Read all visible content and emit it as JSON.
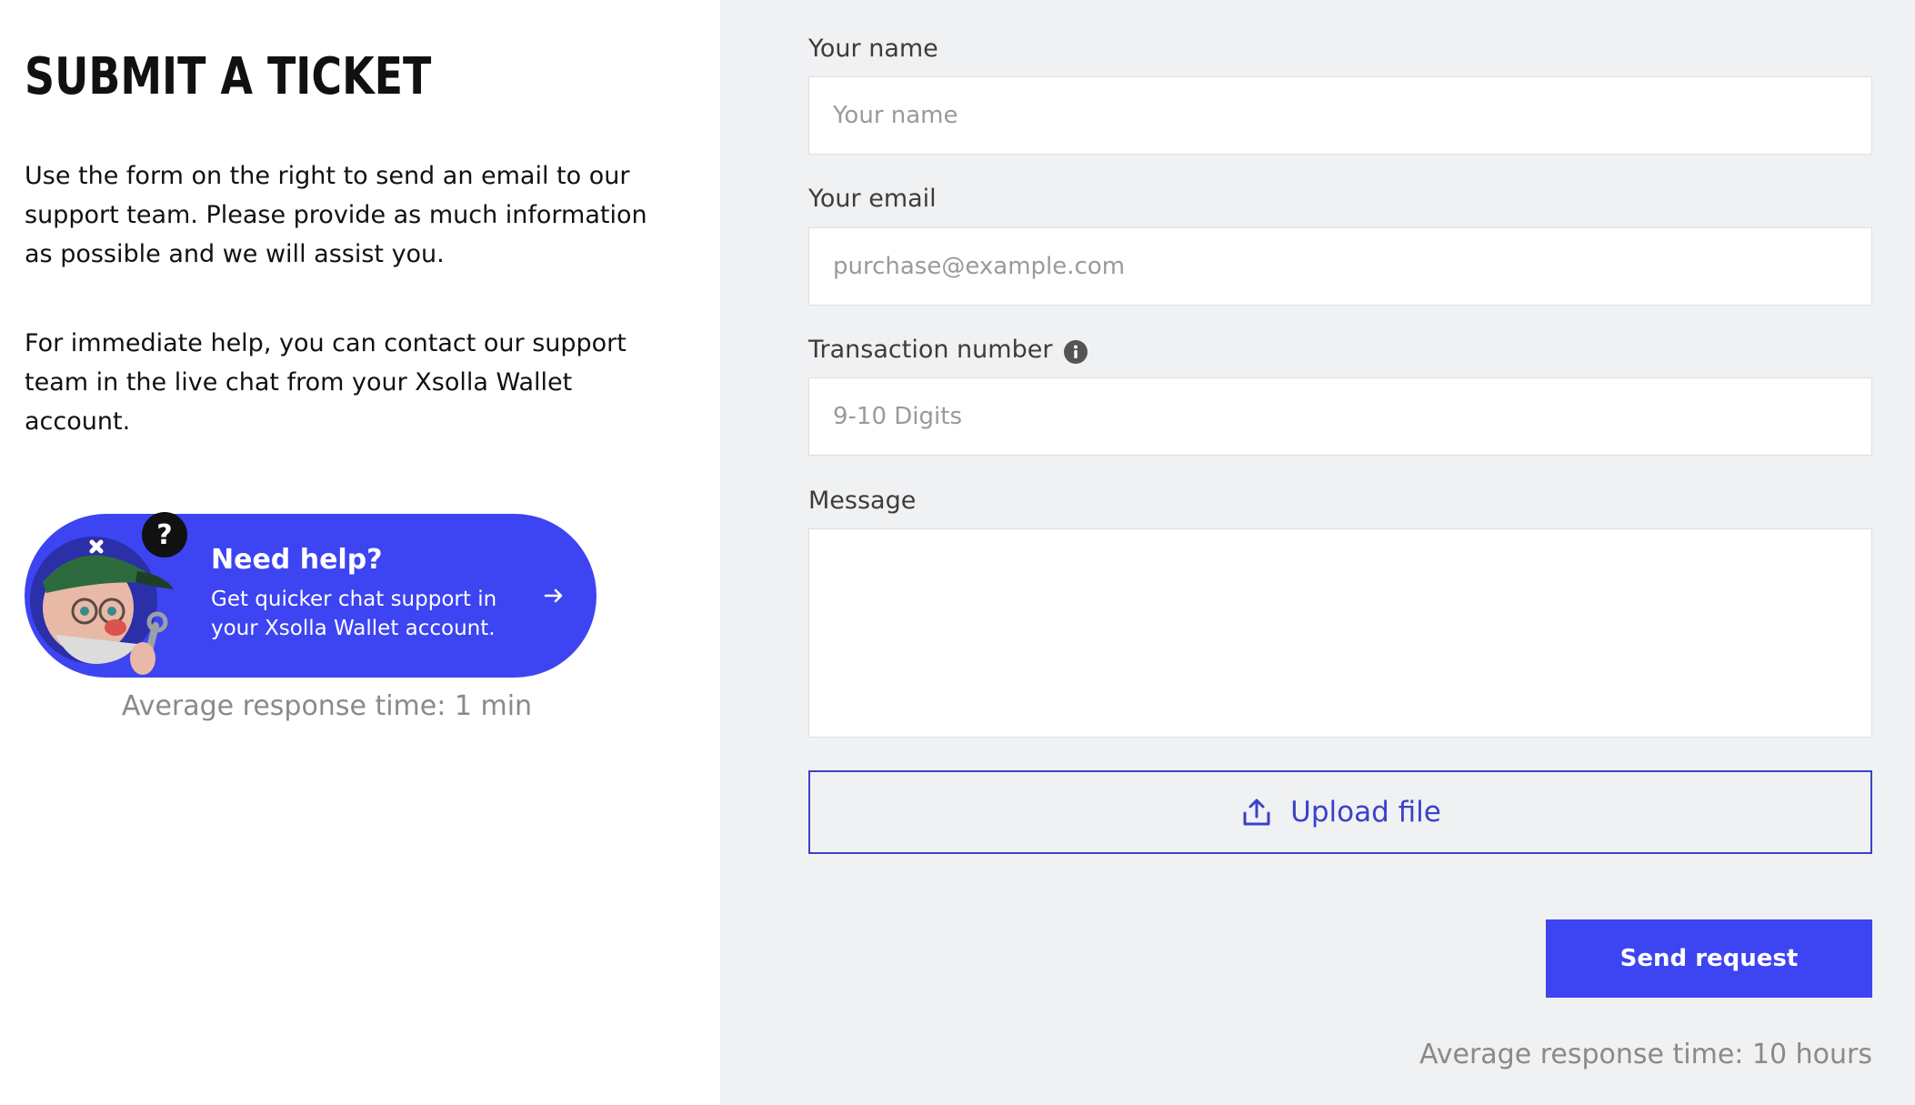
{
  "intro": {
    "title": "SUBMIT A TICKET",
    "paragraph_1": "Use the form on the right to send an email to our support team. Please provide as much information as possible and we will assist you.",
    "paragraph_2": "For immediate help, you can contact our support team in the live chat from your Xsolla Wallet account."
  },
  "help_card": {
    "title": "Need help?",
    "description": "Get quicker chat support in your Xsolla Wallet account.",
    "arrow_icon": "arrow-right-icon",
    "avatar_icon": "support-character-avatar",
    "badge": "?",
    "color": "#3d44f1"
  },
  "left_response_time": "Average response time: 1 min",
  "form": {
    "name": {
      "label": "Your name",
      "placeholder": "Your name",
      "value": ""
    },
    "email": {
      "label": "Your email",
      "placeholder": "purchase@example.com",
      "value": ""
    },
    "transaction": {
      "label": "Transaction number",
      "placeholder": "9-10 Digits",
      "value": "",
      "info_icon": "info-icon"
    },
    "message": {
      "label": "Message",
      "value": ""
    },
    "upload": {
      "label": "Upload file",
      "icon": "upload-icon"
    },
    "submit": {
      "label": "Send request"
    }
  },
  "right_response_time": "Average response time: 10 hours",
  "colors": {
    "accent": "#3d44f1",
    "outline_accent": "#3a42c9",
    "panel_bg": "#f0f1f3",
    "muted_text": "#8a8a8a"
  }
}
